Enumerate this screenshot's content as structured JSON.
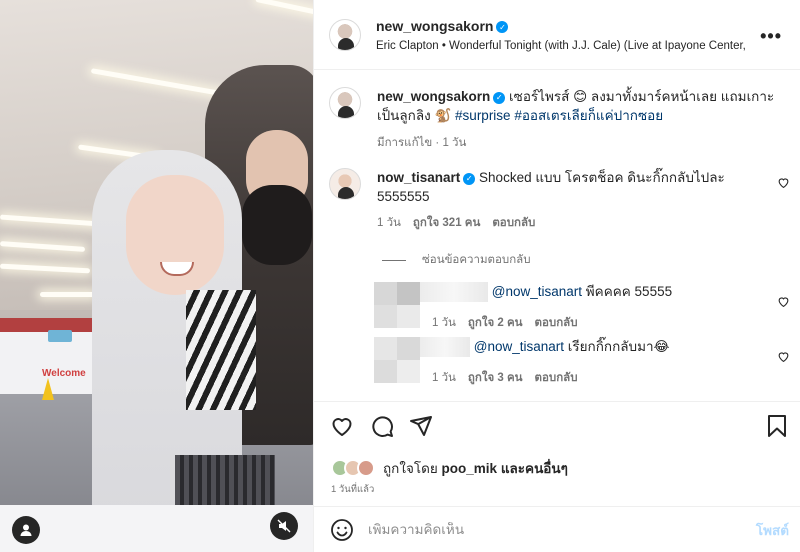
{
  "post": {
    "username": "new_wongsakorn",
    "subline": "Eric Clapton • Wonderful Tonight (with J.J. Cale) (Live at Ipayone Center,"
  },
  "caption": {
    "username": "new_wongsakorn",
    "text": "เซอร์ไพรส์ 😊 ลงมาทั้งมาร์คหน้าเลย แถมเกาะเป็นลูกลิง 🐒 ",
    "hashtags": "#surprise #ออสเตรเลียก็แค่ปากซอย",
    "edited": "มีการแก้ไข",
    "time": "1 วัน"
  },
  "comment1": {
    "username": "now_tisanart",
    "text": "Shocked แบบ โครตช็อค ดินะกิ๊กกลับไปละ 5555555",
    "time": "1 วัน",
    "likes": "ถูกใจ 321 คน",
    "reply": "ตอบกลับ"
  },
  "hide_replies": "ซ่อนข้อความตอบกลับ",
  "reply1": {
    "mention": "@now_tisanart",
    "text": "พีคคคค 55555",
    "time": "1 วัน",
    "likes": "ถูกใจ 2 คน",
    "reply": "ตอบกลับ"
  },
  "reply2": {
    "mention": "@now_tisanart",
    "text": "เรียกกิ๊กกลับมา😂",
    "time": "1 วัน",
    "likes": "ถูกใจ 3 คน",
    "reply": "ตอบกลับ"
  },
  "liked_by": {
    "prefix": "ถูกใจโดย",
    "user": "poo_mik",
    "suffix": "และคนอื่นๆ"
  },
  "time_ago": "1 วันที่แล้ว",
  "comment_box": {
    "placeholder": "เพิ่มความคิดเห็น",
    "post_label": "โพสต์"
  },
  "media_scene": {
    "welcome_sign": "Welcome"
  },
  "colors": {
    "verified": "#0095f6",
    "hashtag": "#00376b",
    "muted": "#737373",
    "post_disabled": "#b3dbff"
  }
}
